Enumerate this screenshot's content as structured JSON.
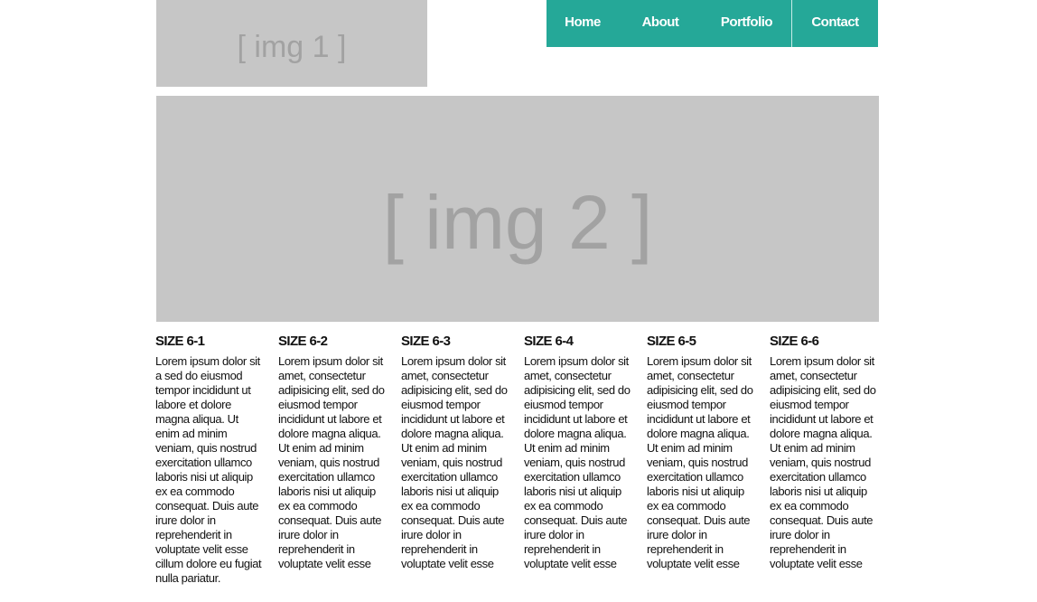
{
  "header": {
    "logo_placeholder": "[ img 1 ]"
  },
  "nav": {
    "items": [
      {
        "label": "Home"
      },
      {
        "label": "About"
      },
      {
        "label": "Portfolio"
      },
      {
        "label": "Contact"
      }
    ],
    "colors": {
      "background": "#25a898",
      "text": "#ffffff"
    }
  },
  "hero": {
    "placeholder": "[ img 2 ]"
  },
  "columns": [
    {
      "title": "SIZE 6-1",
      "text": "Lorem ipsum dolor sit a sed do eiusmod tempor incididunt ut labore et dolore magna aliqua. Ut enim ad minim veniam, quis nostrud exercitation ullamco laboris nisi ut aliquip ex ea commodo consequat. Duis aute irure dolor in reprehenderit in voluptate velit esse cillum dolore eu fugiat nulla pariatur."
    },
    {
      "title": "SIZE 6-2",
      "text": "Lorem ipsum dolor sit amet, consectetur adipisicing elit, sed do eiusmod tempor incididunt ut labore et dolore magna aliqua. Ut enim ad minim veniam, quis nostrud exercitation ullamco laboris nisi ut aliquip ex ea commodo consequat. Duis aute irure dolor in reprehenderit in voluptate velit esse"
    },
    {
      "title": "SIZE 6-3",
      "text": "Lorem ipsum dolor sit amet, consectetur adipisicing elit, sed do eiusmod tempor incididunt ut labore et dolore magna aliqua. Ut enim ad minim veniam, quis nostrud exercitation ullamco laboris nisi ut aliquip ex ea commodo consequat. Duis aute irure dolor in reprehenderit in voluptate velit esse"
    },
    {
      "title": "SIZE 6-4",
      "text": "Lorem ipsum dolor sit amet, consectetur adipisicing elit, sed do eiusmod tempor incididunt ut labore et dolore magna aliqua. Ut enim ad minim veniam, quis nostrud exercitation ullamco laboris nisi ut aliquip ex ea commodo consequat. Duis aute irure dolor in reprehenderit in voluptate velit esse"
    },
    {
      "title": "SIZE 6-5",
      "text": "Lorem ipsum dolor sit amet, consectetur adipisicing elit, sed do eiusmod tempor incididunt ut labore et dolore magna aliqua. Ut enim ad minim veniam, quis nostrud exercitation ullamco laboris nisi ut aliquip ex ea commodo consequat. Duis aute irure dolor in reprehenderit in voluptate velit esse"
    },
    {
      "title": "SIZE 6-6",
      "text": "Lorem ipsum dolor sit amet, consectetur adipisicing elit, sed do eiusmod tempor incididunt ut labore et dolore magna aliqua. Ut enim ad minim veniam, quis nostrud exercitation ullamco laboris nisi ut aliquip ex ea commodo consequat. Duis aute irure dolor in reprehenderit in voluptate velit esse"
    }
  ],
  "colors": {
    "placeholder_bg": "#c6c6c6",
    "placeholder_text": "#a2a2a2",
    "body_text": "#111111"
  }
}
